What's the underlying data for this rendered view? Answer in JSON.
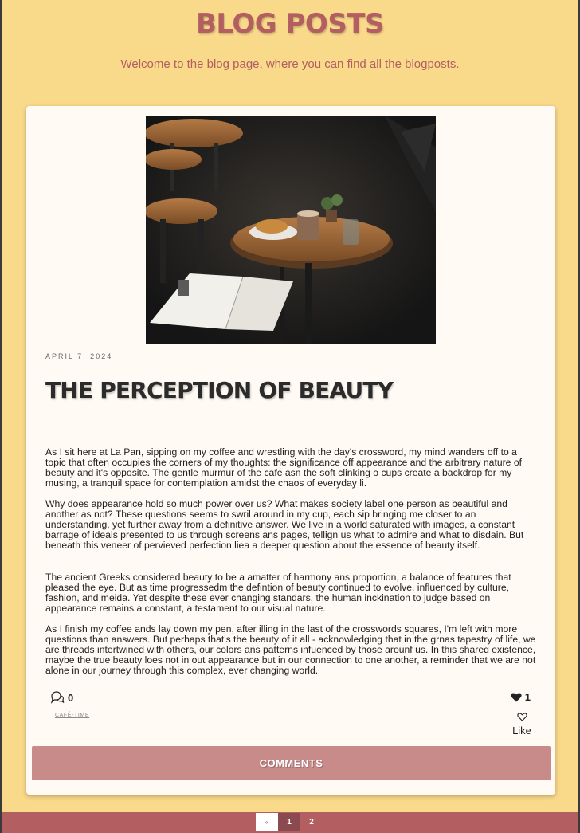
{
  "header": {
    "title": "BLOG POSTS",
    "subtitle": "Welcome to the blog page, where you can find all the blogposts."
  },
  "post": {
    "image_alt": "Cafe table with croissant, coffee and open magazine",
    "date": "APRIL 7, 2024",
    "title": "THE PERCEPTION OF BEAUTY",
    "paragraphs": [
      "As I sit here at La Pan, sipping on my coffee and wrestling with the day's  crossword, my mind wanders off to a topic that often occupies the corners of my thoughts: the significance off appearance and the arbitrary nature of beauty and it's opposite. The gentle murmur of the cafe asn the soft clinking o cups create a backdrop for my musing,  a tranquil space for contemplation amidst the chaos of everyday li.",
      "Why does appearance hold so much power over us? What makes society label one person as beautiful and another as not? These questions seems to swril around in my cup, each sip bringing me closer to an understanding, yet further away from a definitive answer. We live in a world saturated with images, a constant barrage of ideals presented to us through screens ans pages, tellign us what to admire and what to disdain. But beneath this veneer of pervieved perfection liea a deeper question about the essence of beauty itself.",
      "The ancient Greeks considered beauty to be a amatter of harmony ans proportion, a balance of features that pleased the eye. But as time progressedm the defintion of beauty continued to evolve, influenced by culture, fashion, and meida. Yet despite these ever changing standars, the human inckination to judge based on appearance remains a constant, a testament to our visual nature.",
      "As I finish my coffee ands lay down my pen, after illing in the last of the crosswords squares, I'm left with more questions than answers. But perhaps that's the beauty of it all - acknowledging that in the grnas tapestry of life, we are threads intertwined with others, our colors ans patterns infuenced by those arounf us. In this shared existence, maybe the true beauty loes not in out appearance but in our connection to one another, a reminder that we are not alone in our journey through this complex, ever changing world."
    ],
    "comment_count": "0",
    "tag": "CAFÉ-TIME",
    "like_count": "1",
    "like_label": "Like",
    "comments_button": "COMMENTS"
  },
  "pagination": {
    "prev": "«",
    "pages": [
      "1",
      "2"
    ]
  },
  "colors": {
    "background": "#f9d98a",
    "accent": "#b35f62",
    "button": "#c98a8a",
    "card": "#fffaf3"
  }
}
